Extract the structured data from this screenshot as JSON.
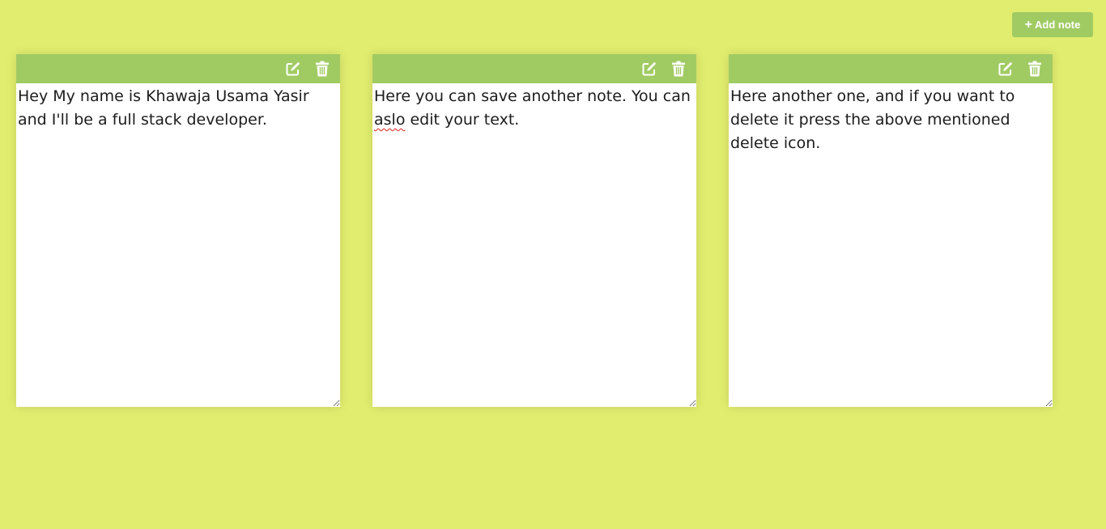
{
  "colors": {
    "background": "#e1ed6e",
    "accent": "#a0cb63",
    "note_body": "#ffffff",
    "text": "#1c1c1c",
    "icon": "#ffffff"
  },
  "toolbar": {
    "add_note_icon": "plus-icon",
    "add_note_label": "Add note"
  },
  "notes": [
    {
      "edit_icon": "edit-icon",
      "delete_icon": "trash-icon",
      "text": "Hey My name is Khawaja Usama Yasir and I'll be a full stack developer."
    },
    {
      "edit_icon": "edit-icon",
      "delete_icon": "trash-icon",
      "text_before": "Here you can save another note. You can ",
      "text_misspelled": "aslo",
      "text_after": " edit your text."
    },
    {
      "edit_icon": "edit-icon",
      "delete_icon": "trash-icon",
      "text": "Here another one, and if you want to delete it press the above mentioned delete icon."
    }
  ]
}
